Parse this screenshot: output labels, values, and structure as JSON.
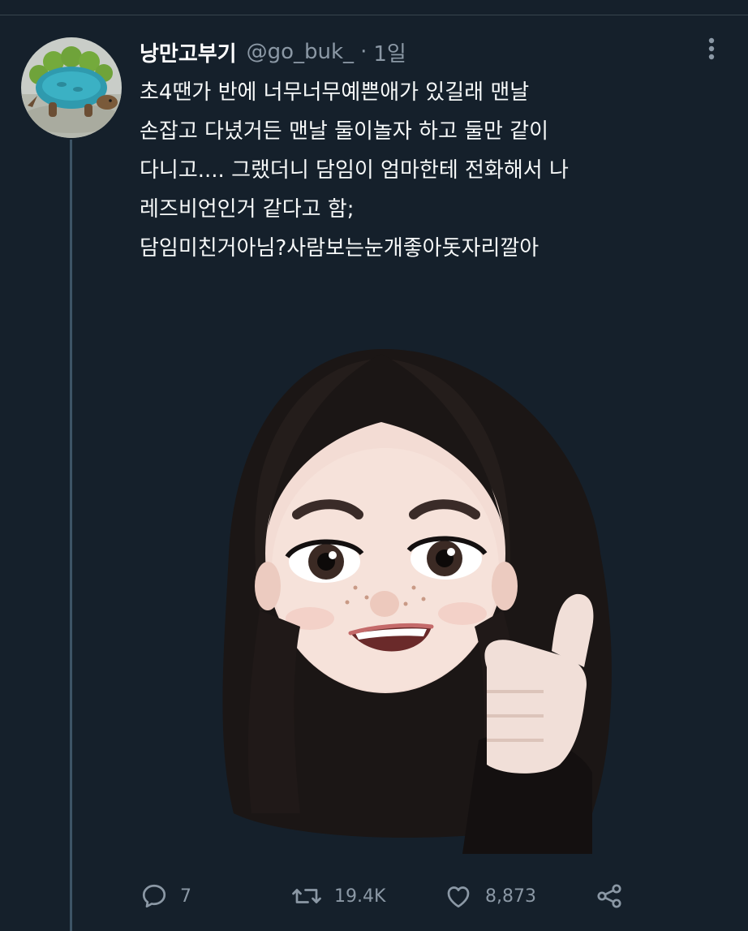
{
  "tweet": {
    "author": {
      "display_name": "낭만고부기",
      "handle": "@go_buk_",
      "avatar_icon": "turtle-in-knit-sweater-avatar"
    },
    "separator": "·",
    "time": "1일",
    "more_icon": "more-vertical-icon",
    "text_lines": [
      "초4땐가 반에 너무너무예쁜애가 있길래 맨날",
      "손잡고 다녔거든 맨날 둘이놀자 하고 둘만 같이",
      "다니고.... 그랬더니 담임이 엄마한테 전화해서 나",
      "레즈비언인거 같다고 함;",
      "담임미친거아님?사람보는눈개좋아돗자리깔아"
    ],
    "media_icon": "memoji-thumbs-up-sticker",
    "actions": {
      "reply_count": "7",
      "retweet_count": "19.4K",
      "like_count": "8,873"
    }
  },
  "colors": {
    "background": "#15202b",
    "text": "#f7f9f9",
    "secondary_text": "#8b98a5",
    "thread_line": "#3d5466"
  }
}
